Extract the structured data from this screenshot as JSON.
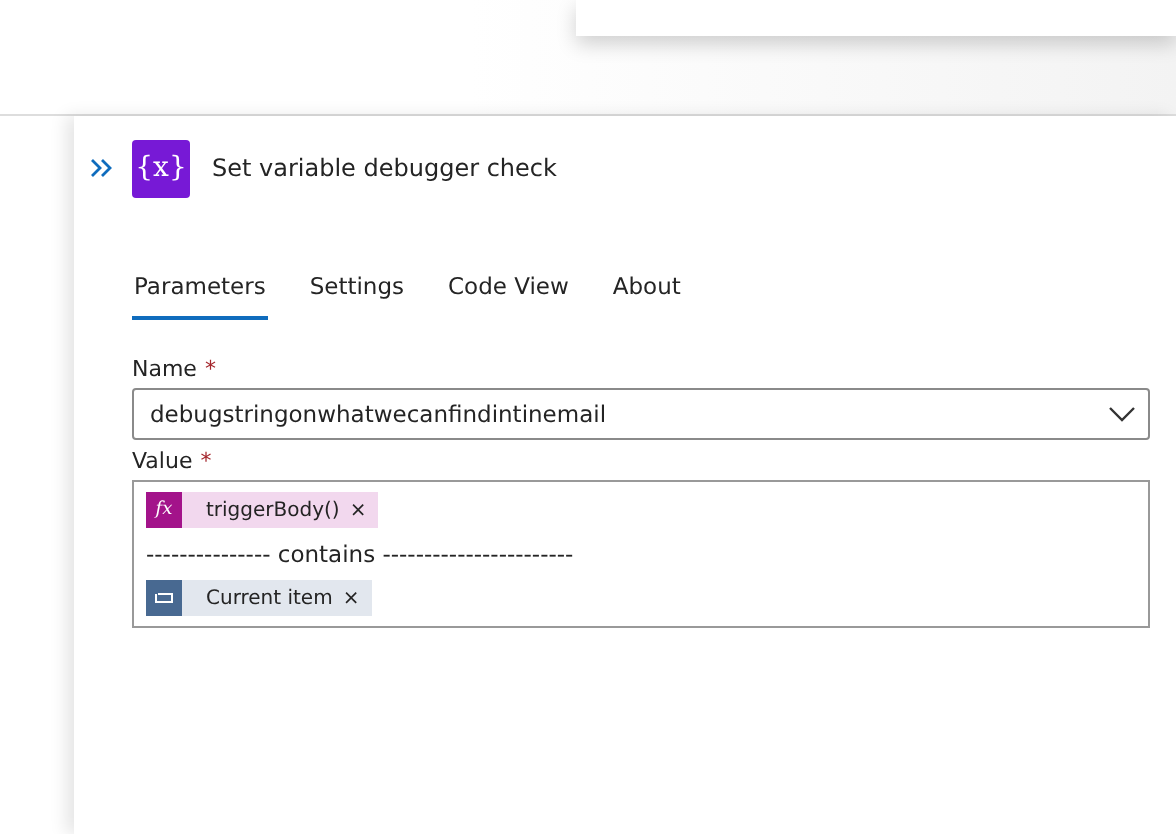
{
  "header": {
    "icon": "{x}",
    "title": "Set variable debugger check"
  },
  "tabs": [
    {
      "label": "Parameters",
      "selected": true
    },
    {
      "label": "Settings",
      "selected": false
    },
    {
      "label": "Code View",
      "selected": false
    },
    {
      "label": "About",
      "selected": false
    }
  ],
  "name_field": {
    "label": "Name",
    "required_mark": "*",
    "value": "debugstringonwhatwecanfindintinemail"
  },
  "value_field": {
    "label": "Value",
    "required_mark": "*",
    "lines": [
      {
        "kind": "function_chip",
        "icon": "fx",
        "text": "triggerBody()",
        "remove": "×"
      },
      {
        "kind": "text",
        "text": "--------------- contains -----------------------"
      },
      {
        "kind": "loop_chip",
        "text": "Current item",
        "remove": "×"
      }
    ]
  }
}
